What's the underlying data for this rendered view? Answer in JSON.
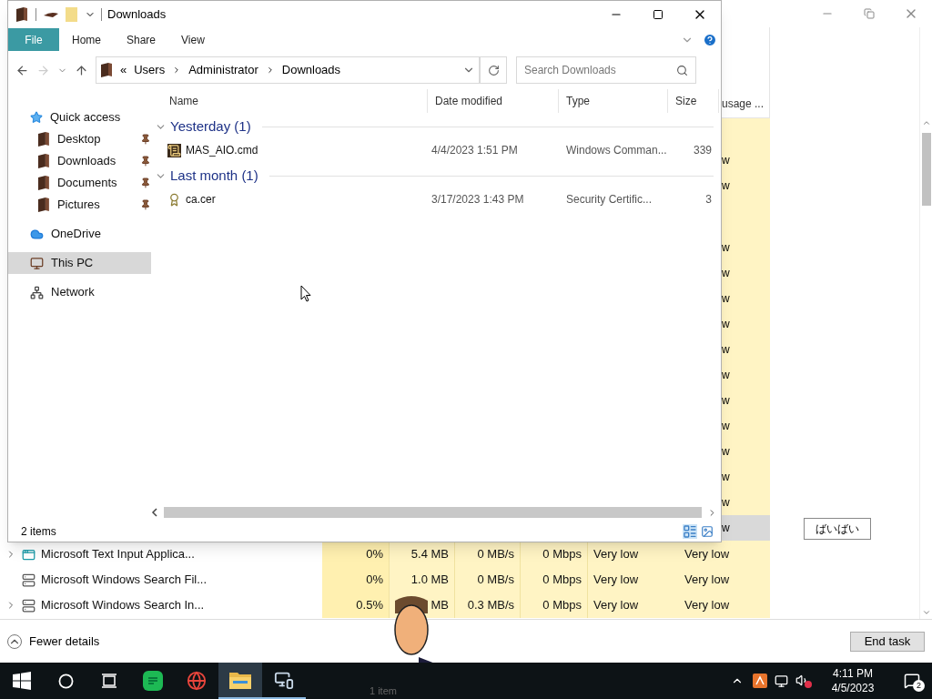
{
  "task_manager": {
    "header_fragment": "usage ...",
    "strip_cells": [
      {
        "text": "w",
        "selected": false
      },
      {
        "text": "w",
        "selected": false
      },
      {
        "text": "w",
        "selected": false
      },
      {
        "text": "w",
        "selected": false
      },
      {
        "text": "w",
        "selected": false
      },
      {
        "text": "w",
        "selected": false
      },
      {
        "text": "w",
        "selected": false
      },
      {
        "text": "w",
        "selected": false
      },
      {
        "text": "w",
        "selected": false
      },
      {
        "text": "w",
        "selected": false
      },
      {
        "text": "w",
        "selected": false
      },
      {
        "text": "w",
        "selected": false
      },
      {
        "text": "w",
        "selected": false
      },
      {
        "text": "w",
        "selected": true
      }
    ],
    "side_button": "ばいばい",
    "rows": [
      {
        "name": "Microsoft Text Input Applica...",
        "expandable": true,
        "kind": "app",
        "cpu": "0%",
        "memory": "5.4 MB",
        "disk": "0 MB/s",
        "network": "0 Mbps",
        "power": "Very low",
        "power_trend": "Very low"
      },
      {
        "name": "Microsoft Windows Search Fil...",
        "expandable": false,
        "kind": "service",
        "cpu": "0%",
        "memory": "1.0 MB",
        "disk": "0 MB/s",
        "network": "0 Mbps",
        "power": "Very low",
        "power_trend": "Very low"
      },
      {
        "name": "Microsoft Windows Search In...",
        "expandable": true,
        "kind": "service",
        "cpu": "0.5%",
        "memory": "MB",
        "disk": "0.3 MB/s",
        "network": "0 Mbps",
        "power": "Very low",
        "power_trend": "Very low"
      }
    ],
    "fewer_details": "Fewer details",
    "end_task": "End task"
  },
  "explorer": {
    "title": "Downloads",
    "ribbon_tabs": [
      {
        "label": "File",
        "selected": true
      },
      {
        "label": "Home",
        "selected": false
      },
      {
        "label": "Share",
        "selected": false
      },
      {
        "label": "View",
        "selected": false
      }
    ],
    "address": {
      "overflow": "«",
      "crumbs": [
        "Users",
        "Administrator",
        "Downloads"
      ]
    },
    "search": {
      "placeholder": "Search Downloads"
    },
    "nav": [
      {
        "label": "Quick access",
        "kind": "quick_access",
        "pinned": false,
        "selected": false,
        "children": [
          {
            "label": "Desktop",
            "kind": "folder",
            "pinned": true,
            "selected": false
          },
          {
            "label": "Downloads",
            "kind": "folder",
            "pinned": true,
            "selected": false
          },
          {
            "label": "Documents",
            "kind": "folder",
            "pinned": true,
            "selected": false
          },
          {
            "label": "Pictures",
            "kind": "folder",
            "pinned": true,
            "selected": false
          }
        ]
      },
      {
        "label": "OneDrive",
        "kind": "cloud",
        "pinned": false,
        "selected": false
      },
      {
        "label": "This PC",
        "kind": "pc",
        "pinned": false,
        "selected": true
      },
      {
        "label": "Network",
        "kind": "network",
        "pinned": false,
        "selected": false
      }
    ],
    "columns": [
      "Name",
      "Date modified",
      "Type",
      "Size"
    ],
    "groups": [
      {
        "label": "Yesterday (1)",
        "expanded": true,
        "files": [
          {
            "name": "MAS_AIO.cmd",
            "kind": "script",
            "date": "4/4/2023 1:51 PM",
            "type": "Windows Comman...",
            "size": "339"
          }
        ]
      },
      {
        "label": "Last month (1)",
        "expanded": true,
        "files": [
          {
            "name": "ca.cer",
            "kind": "certificate",
            "date": "3/17/2023 1:43 PM",
            "type": "Security Certific...",
            "size": "3"
          }
        ]
      }
    ],
    "status": "2 items"
  },
  "taskbar": {
    "apps": [
      {
        "kind": "start"
      },
      {
        "kind": "search"
      },
      {
        "kind": "taskview"
      },
      {
        "kind": "notes",
        "open": false,
        "active": false
      },
      {
        "kind": "browser",
        "open": false,
        "active": false
      },
      {
        "kind": "folder",
        "open": true,
        "active": true
      },
      {
        "kind": "remote",
        "open": true,
        "active": false
      }
    ],
    "ghost_text": "1 item",
    "time": "4:11 PM",
    "date": "4/5/2023",
    "notifications": "2"
  }
}
